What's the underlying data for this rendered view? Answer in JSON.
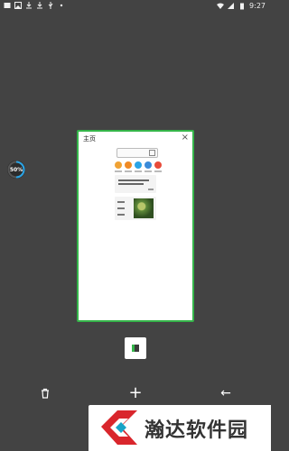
{
  "status_bar": {
    "time": "9:27",
    "left_icons": [
      "message-icon",
      "image-icon",
      "download-icon",
      "download-icon",
      "usb-icon",
      "dot-icon"
    ],
    "right_icons": [
      "wifi-icon",
      "signal-icon",
      "battery-icon"
    ]
  },
  "progress": {
    "label": "50%",
    "value": 0.5
  },
  "tab_card": {
    "title": "主页",
    "close_icon": "close-icon",
    "border_color": "#35b54a"
  },
  "thumbnail": {
    "icon_colors": [
      "#f0a234",
      "#f08a24",
      "#2aa4e6",
      "#3b8bd9",
      "#e84b3a"
    ]
  },
  "bottom_bar": {
    "delete_icon": "trash-icon",
    "add_icon": "+",
    "back_icon": "←"
  },
  "watermark": {
    "text": "瀚达软件园"
  }
}
